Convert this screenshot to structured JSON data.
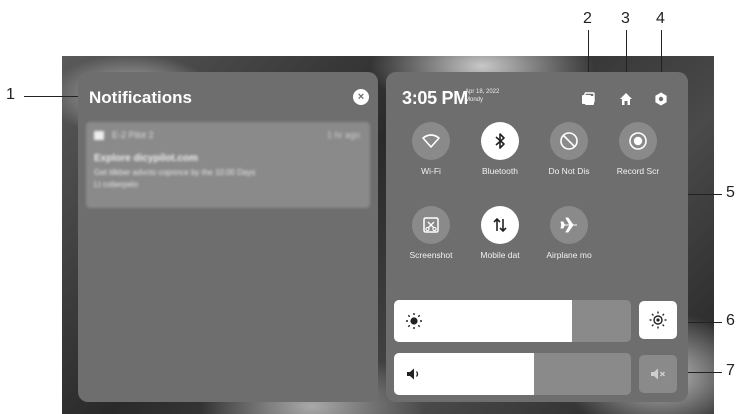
{
  "callouts": [
    "1",
    "2",
    "3",
    "4",
    "5",
    "6",
    "7"
  ],
  "notifications": {
    "title": "Notifications",
    "close_glyph": "×",
    "card": {
      "app_name": "E-2 Pilot 2",
      "time": "1 hr ago",
      "title": "Explore dicypilot.com",
      "body_line1": "Get tilkber advcto copnnce by the 10:00 Days",
      "body_line2": "Lt coberpelo"
    }
  },
  "control_center": {
    "time": "3:05 PM",
    "date_line1": "Apr 18, 2022",
    "date_line2": "Mondy",
    "top_icons": [
      "multi-window-icon",
      "home-icon",
      "settings-icon"
    ],
    "tiles": [
      {
        "label": "Wi-Fi",
        "icon": "wifi-icon",
        "active": false
      },
      {
        "label": "Bluetooth",
        "icon": "bluetooth-icon",
        "active": true
      },
      {
        "label": "Do Not Dis",
        "icon": "do-not-disturb-icon",
        "active": false
      },
      {
        "label": "Record Scr",
        "icon": "record-icon",
        "active": false
      },
      {
        "label": "Screenshot",
        "icon": "screenshot-icon",
        "active": false
      },
      {
        "label": "Mobile dat",
        "icon": "mobile-data-icon",
        "active": true
      },
      {
        "label": "Airplane mo",
        "icon": "airplane-icon",
        "active": false
      }
    ],
    "brightness": {
      "level": 0.75,
      "icon": "brightness-icon",
      "auto_icon": "auto-brightness-icon"
    },
    "volume": {
      "level": 0.59,
      "icon": "volume-icon",
      "mute_icon": "mute-icon"
    }
  },
  "colors": {
    "panel": "#6e6e6e",
    "tile_off": "#8a8a8a",
    "tile_on": "#ffffff"
  }
}
